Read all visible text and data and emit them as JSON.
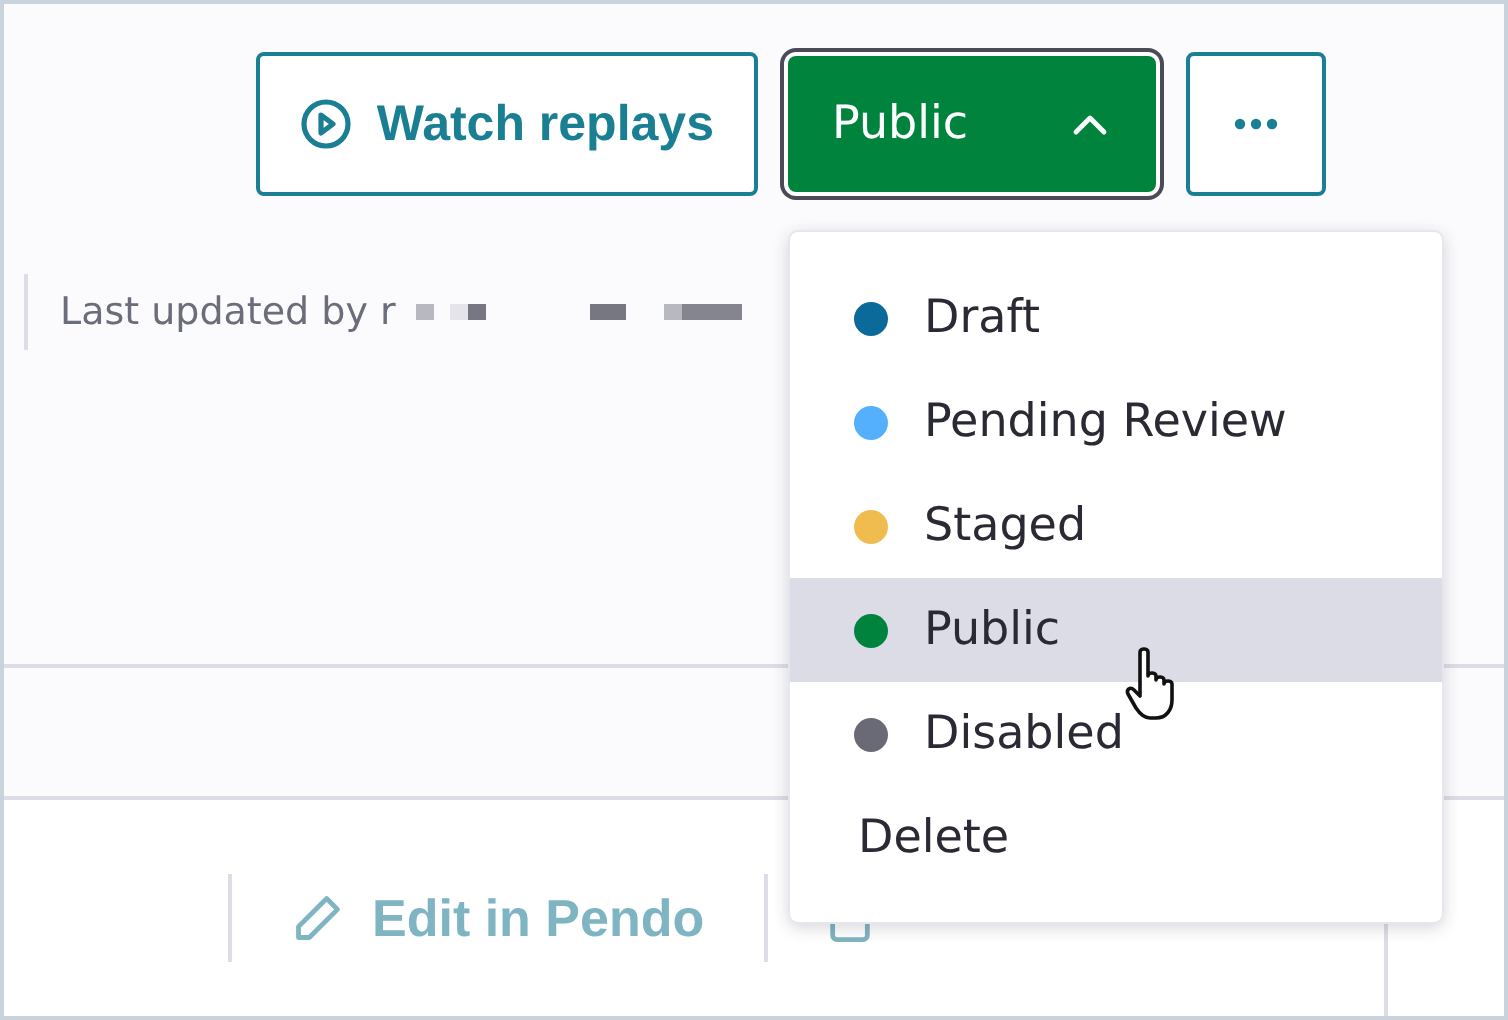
{
  "actions": {
    "watch_replays": "Watch replays",
    "status_button": {
      "label": "Public",
      "expanded": true
    }
  },
  "last_updated": "Last updated by r",
  "status_menu": {
    "items": [
      {
        "label": "Draft",
        "kind": "status",
        "color": "#0b6a9a",
        "selected": false
      },
      {
        "label": "Pending Review",
        "kind": "status",
        "color": "#54affc",
        "selected": false
      },
      {
        "label": "Staged",
        "kind": "status",
        "color": "#f0bc4f",
        "selected": false
      },
      {
        "label": "Public",
        "kind": "status",
        "color": "#00843d",
        "selected": true
      },
      {
        "label": "Disabled",
        "kind": "status",
        "color": "#6a6a76",
        "selected": false
      },
      {
        "label": "Delete",
        "kind": "action",
        "selected": false
      }
    ]
  },
  "edit_links": [
    {
      "label": "Edit in Pendo",
      "kind": "pencil"
    },
    {
      "kind": "app"
    }
  ]
}
